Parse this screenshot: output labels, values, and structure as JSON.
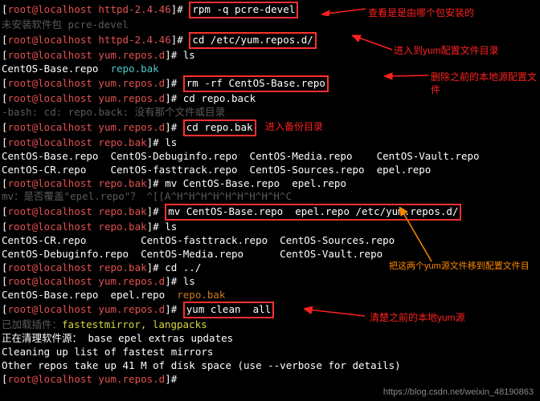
{
  "prompts": {
    "httpd": "root@localhost httpd-2.4.46",
    "repos": "root@localhost yum.repos.d",
    "bak": "root@localhost repo.bak"
  },
  "cmds": {
    "rpm": "rpm -q pcre-devel",
    "cd_repos": "cd /etc/yum.repos.d/",
    "ls": "ls",
    "rm": "rm -rf CentOS-Base.repo",
    "cd_back": "cd repo.back",
    "cd_bak": "cd repo.bak",
    "mv1": "mv CentOS-Base.repo  epel.repo",
    "mv2": "mv CentOS-Base.repo  epel.repo /etc/yum.repos.d/",
    "cd_up": "cd ../",
    "yum_clean": "yum clean  all"
  },
  "out": {
    "not_installed": "未安装软件包 pcre-devel",
    "base_repo": "CentOS-Base.repo",
    "repo_bak": "repo.bak",
    "bash_err": "-bash: cd: repo.back: 没有那个文件或目录",
    "ls_bak_l1a": "CentOS-Base.repo  CentOS-Debuginfo.repo  CentOS-Media.repo    CentOS-Vault.repo",
    "ls_bak_l2a": "CentOS-CR.repo    CentOS-fasttrack.repo  CentOS-Sources.repo  epel.repo",
    "mv_overwrite": "mv：是否覆盖\"epel.repo\"？ ^[[A^H^H^H^H^H^H^H^H^H^C",
    "ls_bak_l1b": "CentOS-CR.repo         CentOS-fasttrack.repo  CentOS-Sources.repo",
    "ls_bak_l2b": "CentOS-Debuginfo.repo  CentOS-Media.repo      CentOS-Vault.repo",
    "ls_repos_l1": "CentOS-Base.repo  epel.repo  ",
    "plugins": "已加载插件：",
    "plugins_val": "fastestmirror, langpacks",
    "cleaning": "正在清理软件源： base epel extras updates",
    "cleaning2": "Cleaning up list of fastest mirrors",
    "other_repos": "Other repos take up 41 M of disk space (use --verbose for details)"
  },
  "annots": {
    "a1": "查看是是由哪个包安装的",
    "a2": "进入到yum配置文件目录",
    "a3": "删除之前的本地源配置文件",
    "a4": "进入备份目录",
    "a5": "把这两个yum源文件移到配置文件目",
    "a6": "清楚之前的本地yum源"
  },
  "watermark": "https://blog.csdn.net/weixin_48190863"
}
